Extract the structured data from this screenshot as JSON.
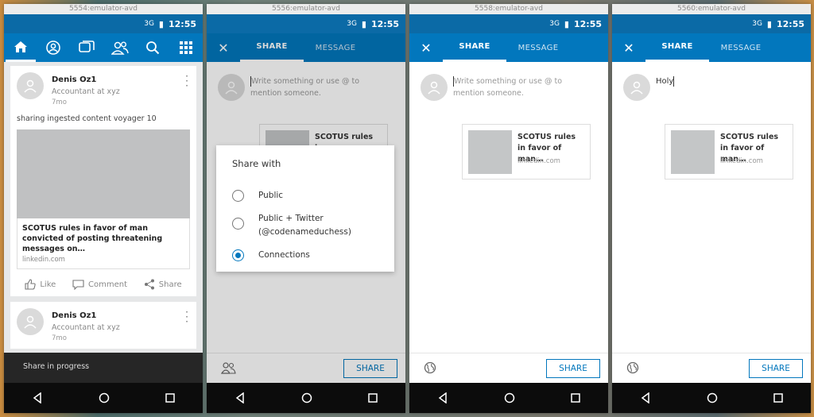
{
  "windows": [
    {
      "title": "5554:emulator-avd",
      "time": "12:55"
    },
    {
      "title": "5556:emulator-avd",
      "time": "12:55"
    },
    {
      "title": "5558:emulator-avd",
      "time": "12:55"
    },
    {
      "title": "5560:emulator-avd",
      "time": "12:55"
    }
  ],
  "status_signal": "3G",
  "feed": {
    "post1": {
      "name": "Denis Oz1",
      "headline": "Accountant at xyz",
      "time": "7mo",
      "text": "sharing ingested content voyager 10",
      "link_title": "SCOTUS rules in favor of man convicted of posting threatening messages on…",
      "link_domain": "linkedin.com"
    },
    "post2": {
      "name": "Denis Oz1",
      "headline": "Accountant at xyz",
      "time": "7mo"
    },
    "actions": {
      "like": "Like",
      "comment": "Comment",
      "share": "Share"
    },
    "snackbar": "Share in progress"
  },
  "share": {
    "tab_share": "SHARE",
    "tab_message": "MESSAGE",
    "placeholder": "Write something or use @ to mention someone.",
    "typed_text": "Holy",
    "link_title": "SCOTUS rules in favor of man…",
    "link_title_w2": "SCOTUS rules in",
    "link_domain": "linkedin.com",
    "button": "SHARE"
  },
  "dialog": {
    "title": "Share with",
    "options": [
      "Public",
      "Public + Twitter (@codenameduchess)",
      "Connections"
    ],
    "selected": "Connections"
  },
  "colors": {
    "primary": "#0277bd",
    "statusbar": "#0b6aa6",
    "navbar": "#0c0c0c"
  }
}
